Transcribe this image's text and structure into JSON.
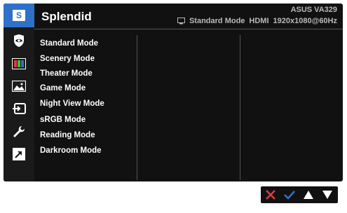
{
  "title": "Splendid",
  "brand": "ASUS  VA329",
  "status": {
    "mode": "Standard Mode",
    "input": "HDMI",
    "resolution": "1920x1080@60Hz"
  },
  "sidebar": {
    "items": [
      {
        "name": "splendid-icon",
        "glyph": "S",
        "selected": true
      },
      {
        "name": "eye-care-icon"
      },
      {
        "name": "color-icon"
      },
      {
        "name": "image-icon"
      },
      {
        "name": "input-select-icon"
      },
      {
        "name": "system-setup-icon"
      },
      {
        "name": "shortcut-icon"
      }
    ]
  },
  "modes": [
    "Standard Mode",
    "Scenery Mode",
    "Theater Mode",
    "Game Mode",
    "Night View Mode",
    "sRGB Mode",
    "Reading Mode",
    "Darkroom Mode"
  ],
  "buttons": [
    {
      "name": "exit-x-icon",
      "color": "#e33a3a"
    },
    {
      "name": "confirm-check-icon",
      "color": "#2f71c9"
    },
    {
      "name": "up-arrow-icon",
      "color": "#ffffff"
    },
    {
      "name": "down-arrow-icon",
      "color": "#ffffff"
    }
  ],
  "colors": {
    "accent": "#2f71c9",
    "background": "#111111",
    "text": "#ffffff",
    "muted_text": "#b9b9b9"
  }
}
